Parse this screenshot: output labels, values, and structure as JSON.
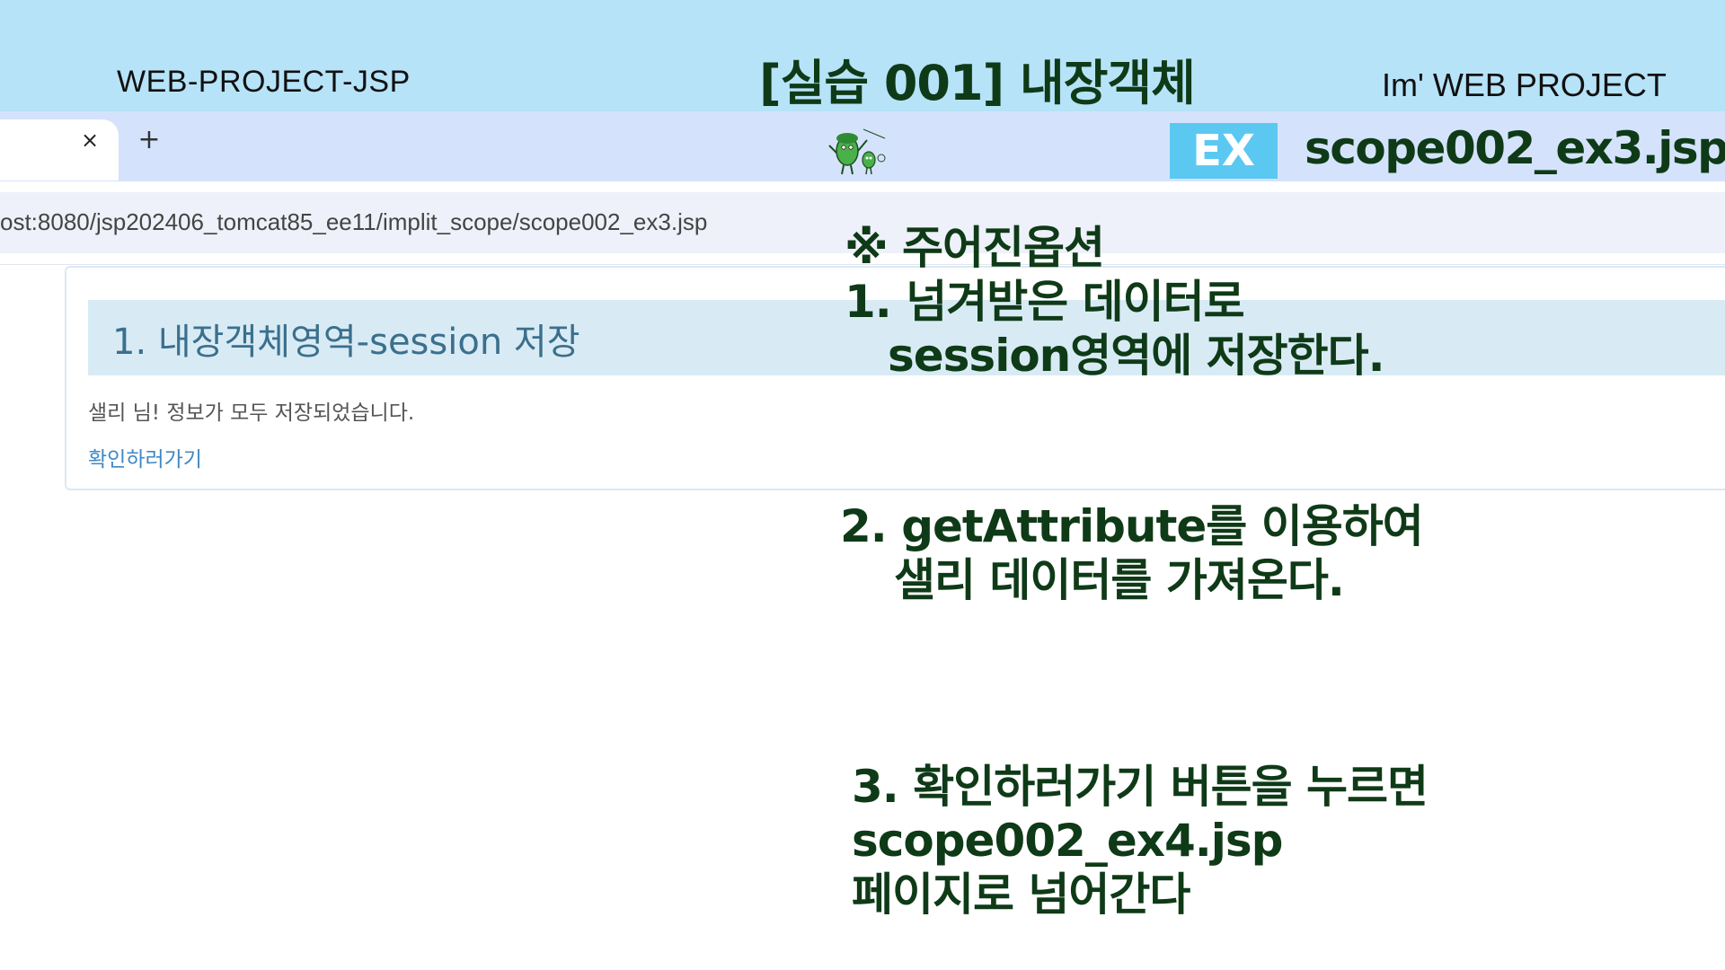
{
  "banner": {
    "brand_left": "WEB-PROJECT-JSP",
    "lesson_title": "[실습 001]  내장객체",
    "brand_right": "Im'  WEB PROJECT"
  },
  "browser": {
    "tab_close": "×",
    "new_tab": "+",
    "address": "ost:8080/jsp202406_tomcat85_ee11/implit_scope/scope002_ex3.jsp"
  },
  "exercise": {
    "badge": "EX",
    "file": "scope002_ex3.jsp"
  },
  "page": {
    "heading": "1. 내장객체영역-session 저장",
    "message": "샐리 님! 정보가 모두 저장되었습니다.",
    "link": "확인하러가기"
  },
  "instructions": {
    "note_title": "※ 주어진옵션",
    "step1_line1": "1. 넘겨받은 데이터로",
    "step1_line2": "session영역에 저장한다.",
    "step2_line1": "2. getAttribute를 이용하여",
    "step2_line2": "샐리 데이터를 가져온다.",
    "step3_line1": "3.  확인하러가기 버튼을 누르면",
    "step3_line2": "scope002_ex4.jsp",
    "step3_line3": "페이지로 넘어간다"
  },
  "colors": {
    "banner_bg": "#b6e3f8",
    "tab_strip_bg": "#d4e3fb",
    "accent_badge": "#5bc8f2",
    "dark_green_text": "#0f3a17",
    "panel_heading_bg": "#d8ebf5",
    "link_color": "#3f88c5"
  },
  "icons": [
    "close-icon",
    "plus-icon",
    "mascot-icon"
  ]
}
